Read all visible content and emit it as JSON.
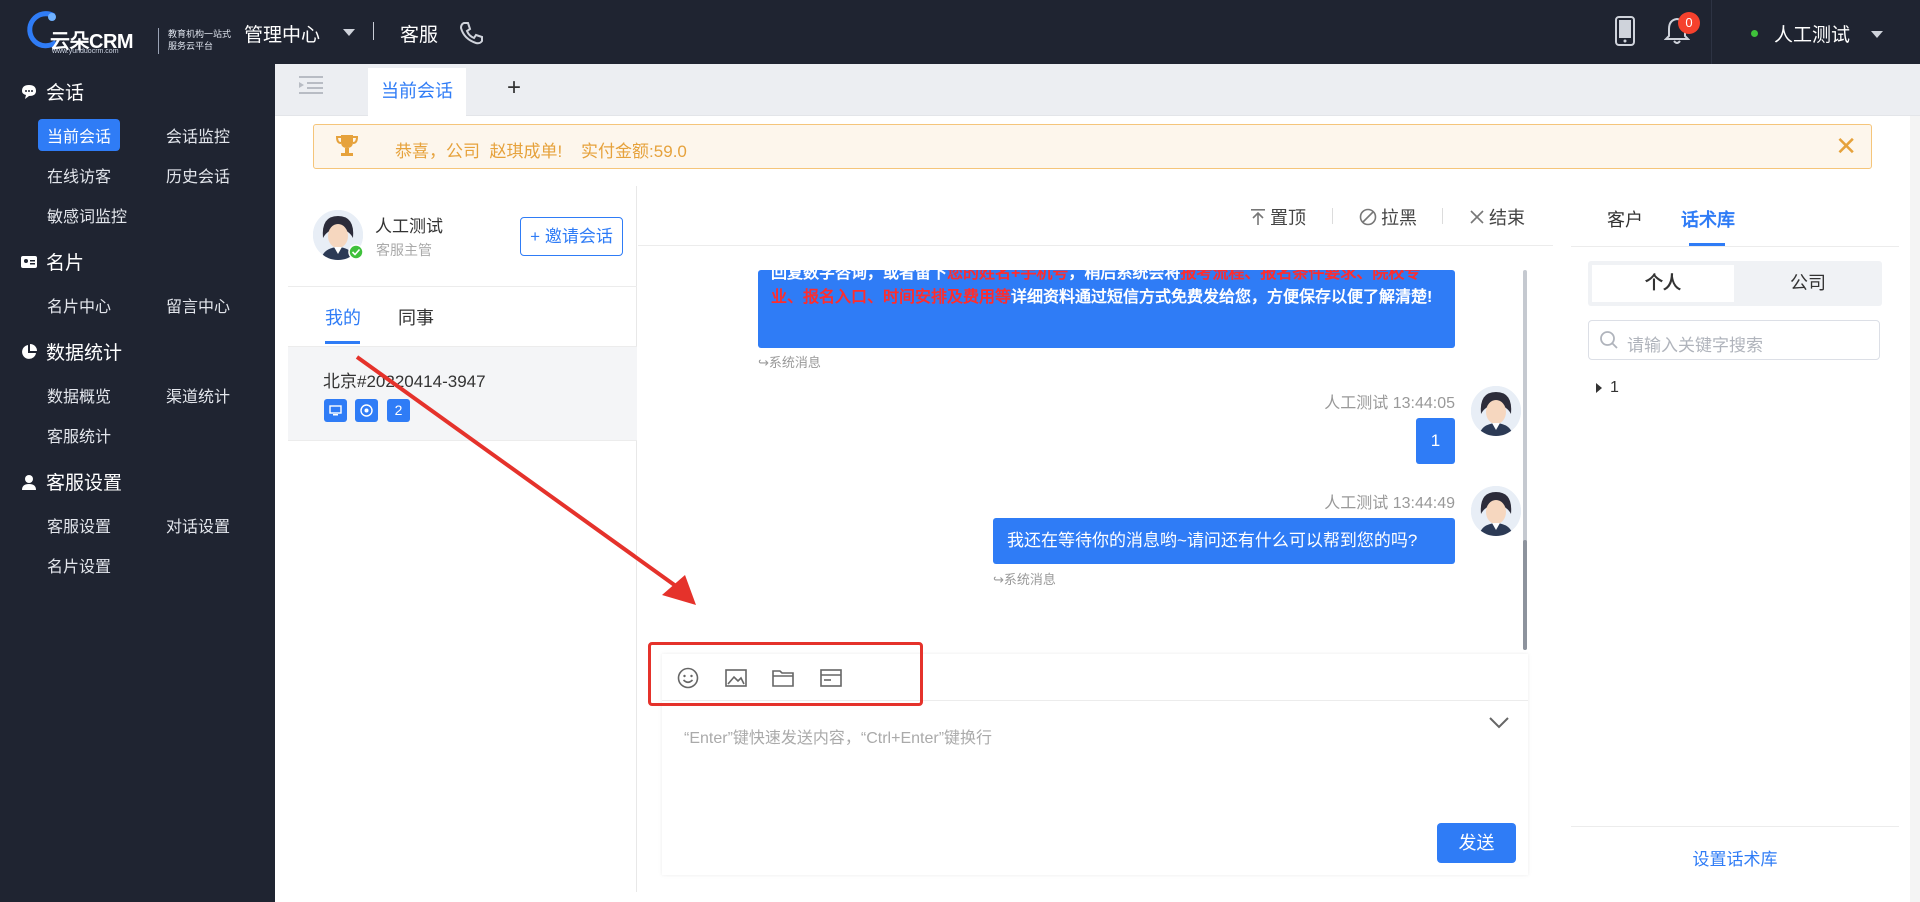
{
  "header": {
    "brand": "云朵CRM",
    "domain": "www.yunduocrm.com",
    "tagline": "教育机构一站式服务云平台",
    "nav_admin": "管理中心",
    "nav_service": "客服",
    "notification_count": "0",
    "user_name": "人工测试",
    "status_color": "#3fc13b"
  },
  "sidebar": {
    "sections": [
      {
        "title": "会话",
        "icon": "chat-bubble-icon",
        "items": [
          "当前会话",
          "会话监控",
          "在线访客",
          "历史会话",
          "敏感词监控"
        ]
      },
      {
        "title": "名片",
        "icon": "id-card-icon",
        "items": [
          "名片中心",
          "留言中心"
        ]
      },
      {
        "title": "数据统计",
        "icon": "pie-chart-icon",
        "items": [
          "数据概览",
          "渠道统计",
          "客服统计"
        ]
      },
      {
        "title": "客服设置",
        "icon": "agent-icon",
        "items": [
          "客服设置",
          "对话设置",
          "名片设置"
        ]
      }
    ],
    "active_item": "当前会话"
  },
  "tabs": {
    "active": "当前会话",
    "add": "+"
  },
  "notice": {
    "text": "恭喜，公司  赵琪成单!    实付金额:59.0",
    "close": "✕"
  },
  "agent": {
    "name": "人工测试",
    "role": "客服主管",
    "invite": "+ 邀请会话"
  },
  "conv_tabs": {
    "mine": "我的",
    "colleague": "同事"
  },
  "conversation": {
    "name": "北京#20220414-3947",
    "chip_count": "2"
  },
  "chat_actions": {
    "pin": "置顶",
    "block": "拉黑",
    "end": "结束"
  },
  "messages": {
    "m1_part1": "回复数字咨询，或者留下",
    "m1_red1": "您的姓名+手机号",
    "m1_part2": "，稍后系统会将",
    "m1_red2": "报考流程、报名条件要求、院校专业、报名入口、时间安排及费用等",
    "m1_part3": "详细资料通过短信方式免费发给您，方便保存以便了解清楚!",
    "sys_label": "系统消息",
    "m2_head": "人工测试 13:44:05",
    "m2_text": "1",
    "m3_head": "人工测试 13:44:49",
    "m3_text": "我还在等待你的消息哟~请问还有什么可以帮到您的吗?"
  },
  "composer": {
    "placeholder": "“Enter”键快速发送内容，“Ctrl+Enter”键换行",
    "send": "发送"
  },
  "right": {
    "tab_customer": "客户",
    "tab_scripts": "话术库",
    "seg_personal": "个人",
    "seg_company": "公司",
    "search_placeholder": "请输入关键字搜索",
    "tree_item": "1",
    "footer": "设置话术库"
  },
  "colors": {
    "primary": "#2f7cf6",
    "sidebar": "#1f2431",
    "warning": "#e6a23c",
    "annotation": "#e5322b"
  }
}
